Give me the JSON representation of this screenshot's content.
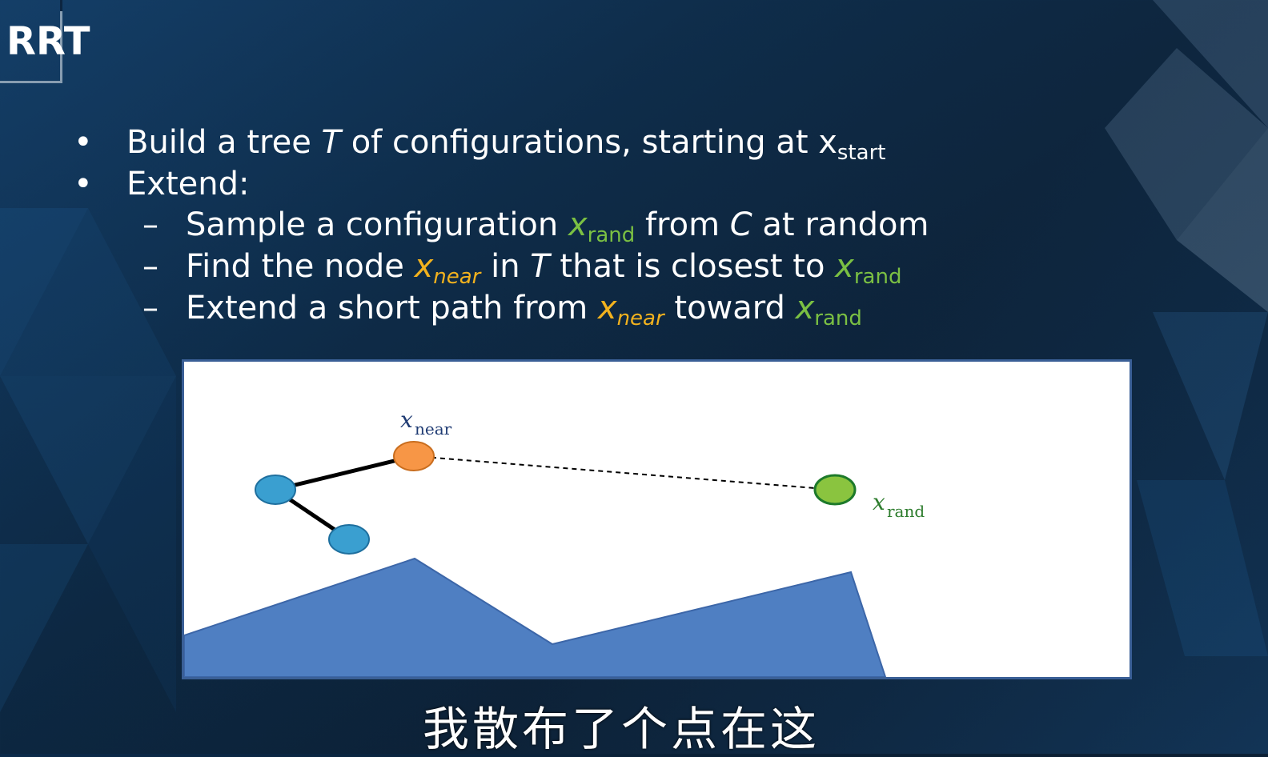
{
  "slide": {
    "title": "RRT",
    "bullets": [
      {
        "marker": "•",
        "parts": {
          "a": "Build a tree ",
          "T": "T",
          "b": " of configurations, starting at x",
          "sub": "start"
        }
      },
      {
        "marker": "•",
        "parts": {
          "a": "Extend:"
        }
      },
      {
        "marker": "–",
        "parts": {
          "a": "Sample a configuration ",
          "x": "x",
          "xsub": "rand",
          "b": " from ",
          "C": "C",
          "c": " at random"
        }
      },
      {
        "marker": "–",
        "parts": {
          "a": "Find the node ",
          "x1": "x",
          "x1sub": "near",
          "b": " in ",
          "T": "T",
          "c": " that is closest to ",
          "x2": "x",
          "x2sub": "rand"
        }
      },
      {
        "marker": "–",
        "parts": {
          "a": "Extend a short path from ",
          "x1": "x",
          "x1sub": "near",
          "b": " toward ",
          "x2": "x",
          "x2sub": "rand"
        }
      }
    ]
  },
  "diagram": {
    "labels": {
      "near_x": "x",
      "near_sub": "near",
      "rand_x": "x",
      "rand_sub": "rand"
    },
    "colors": {
      "tree_node": "#3a9fd0",
      "near_node": "#f79646",
      "rand_node": "#8ac43f",
      "obstacle": "#4f7fc2",
      "near_label": "#1f3b73",
      "rand_label": "#2e7d2e"
    }
  },
  "subtitle": "我散布了个点在这",
  "colors": {
    "highlight_yellow": "#f2b21e",
    "highlight_green": "#7bc043"
  }
}
